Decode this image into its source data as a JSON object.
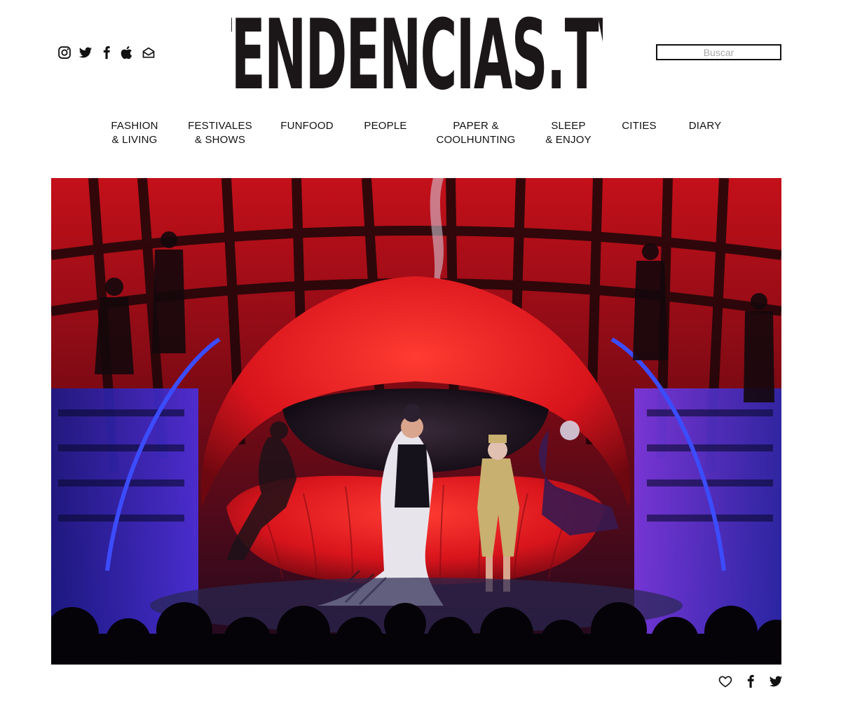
{
  "header": {
    "logo": "TENDENCIAS.TV",
    "search": {
      "placeholder": "Buscar"
    },
    "social_icons": [
      "instagram-icon",
      "twitter-icon",
      "facebook-icon",
      "apple-icon",
      "mail-icon"
    ]
  },
  "nav": {
    "items": [
      {
        "label": "FASHION\n& LIVING"
      },
      {
        "label": "FESTIVALES\n& SHOWS"
      },
      {
        "label": "FUNFOOD"
      },
      {
        "label": "PEOPLE"
      },
      {
        "label": "PAPER &\nCOOLHUNTING"
      },
      {
        "label": "SLEEP\n& ENJOY"
      },
      {
        "label": "CITIES"
      },
      {
        "label": "DIARY"
      }
    ]
  },
  "hero": {
    "image_subject": "stage performance with giant red lips set, performers and audience silhouettes"
  },
  "share": {
    "icons": [
      "heart-icon",
      "facebook-icon",
      "twitter-icon"
    ]
  },
  "colors": {
    "text": "#111111",
    "logo": "#1b1719",
    "stage_red": "#d8141c",
    "stage_blue": "#3c2ad8"
  }
}
